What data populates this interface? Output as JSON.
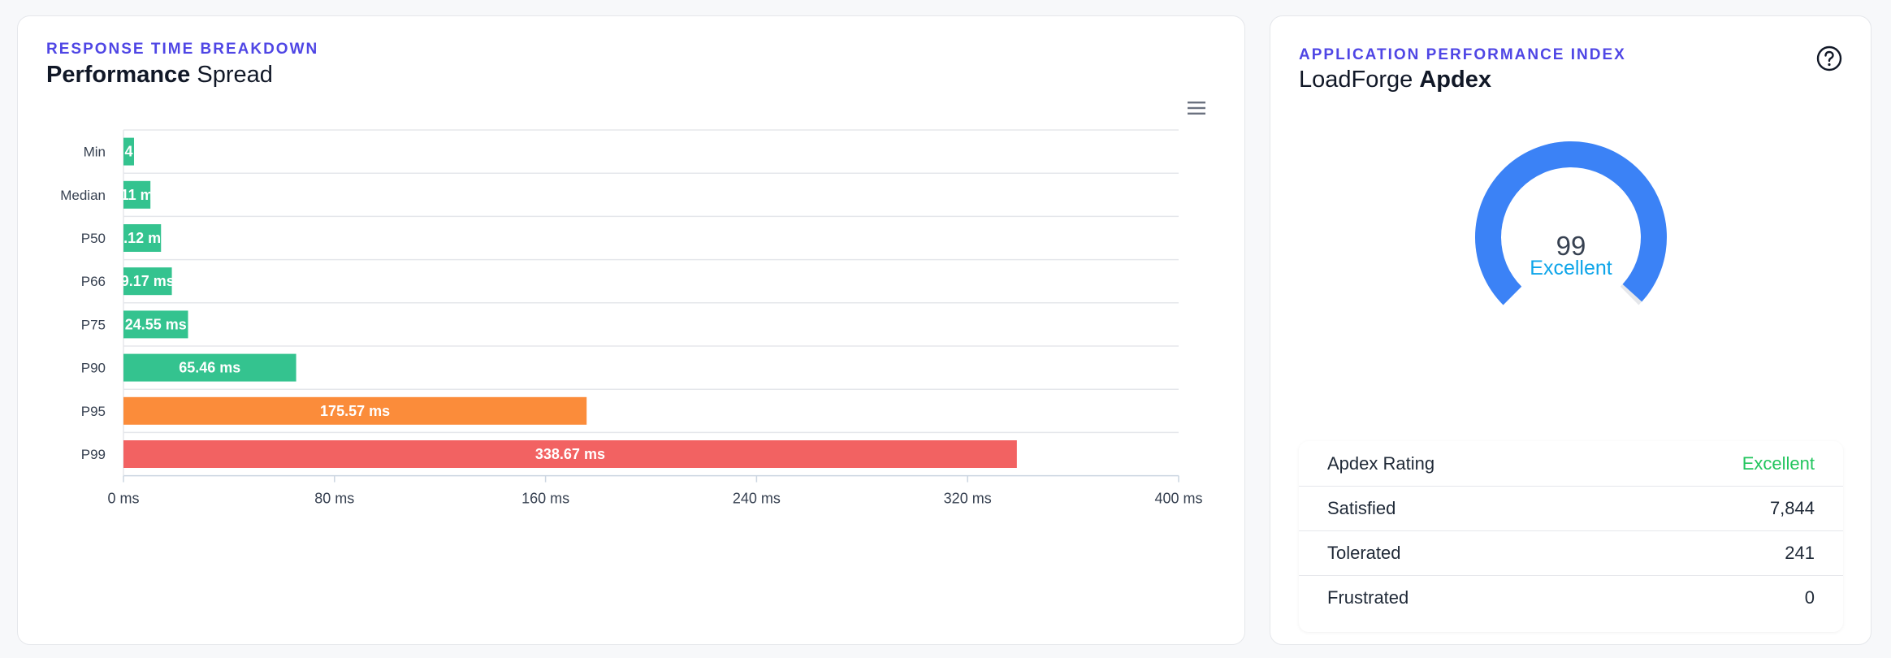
{
  "left_card": {
    "eyebrow": "RESPONSE TIME BREAKDOWN",
    "title_a": "Performance",
    "title_b": "Spread",
    "menu_icon": "hamburger-menu-icon"
  },
  "chart_data": {
    "type": "bar",
    "orientation": "horizontal",
    "categories": [
      "Min",
      "Median",
      "P50",
      "P66",
      "P75",
      "P90",
      "P95",
      "P99"
    ],
    "values": [
      2,
      5.11,
      7.12,
      9.17,
      12.24,
      32.73,
      87.79,
      169.34
    ],
    "value_labels": [
      "4",
      "11 m",
      ".12 m",
      "9.17 ms",
      "24.55 ms",
      "65.46 ms",
      "175.57 ms",
      "338.67 ms"
    ],
    "bar_colors": [
      "#34c38f",
      "#34c38f",
      "#34c38f",
      "#34c38f",
      "#34c38f",
      "#34c38f",
      "#fb8c3a",
      "#f26262"
    ],
    "xlim": [
      0,
      200
    ],
    "x_ticks": [
      "0 ms",
      "80 ms",
      "160 ms",
      "240 ms",
      "320 ms",
      "400 ms"
    ],
    "x_tick_values": [
      0,
      40,
      80,
      120,
      160,
      200
    ],
    "grid": "horizontal lines between categories"
  },
  "right_card": {
    "eyebrow": "APPLICATION PERFORMANCE INDEX",
    "title_a": "LoadForge",
    "title_b": "Apdex",
    "help_icon": "question-circle-icon"
  },
  "gauge": {
    "value": "99",
    "label": "Excellent",
    "fill_fraction": 0.99,
    "color": "#3b82f6",
    "label_color": "#0ea5e9"
  },
  "apdex_table": {
    "rows": [
      {
        "label": "Apdex Rating",
        "value": "Excellent"
      },
      {
        "label": "Satisfied",
        "value": "7,844"
      },
      {
        "label": "Tolerated",
        "value": "241"
      },
      {
        "label": "Frustrated",
        "value": "0"
      }
    ],
    "rating_color": "#22c55e"
  }
}
